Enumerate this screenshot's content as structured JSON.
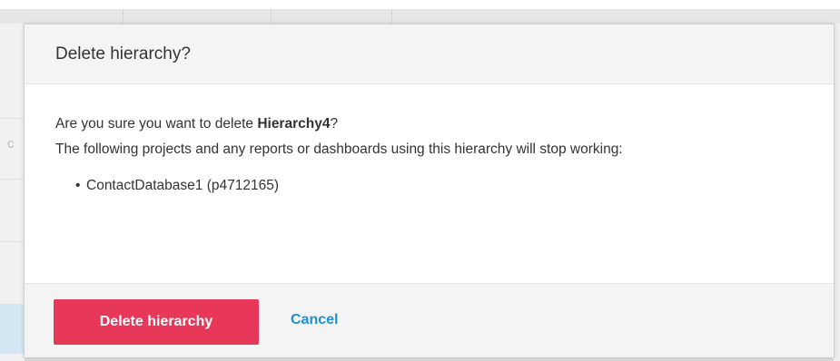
{
  "background": {
    "left_fragment": "c"
  },
  "dialog": {
    "title": "Delete hierarchy?",
    "message_prefix": "Are you sure you want to delete ",
    "hierarchy_name": "Hierarchy4",
    "message_suffix": "?",
    "warning": "The following projects and any reports or dashboards using this hierarchy will stop working:",
    "affected_projects": [
      "ContactDatabase1 (p4712165)"
    ],
    "bullet_glyph": "•",
    "confirm_label": "Delete hierarchy",
    "cancel_label": "Cancel"
  },
  "colors": {
    "danger": "#e8385a",
    "link": "#1f8fd6",
    "header_bg": "#f4f4f4"
  }
}
